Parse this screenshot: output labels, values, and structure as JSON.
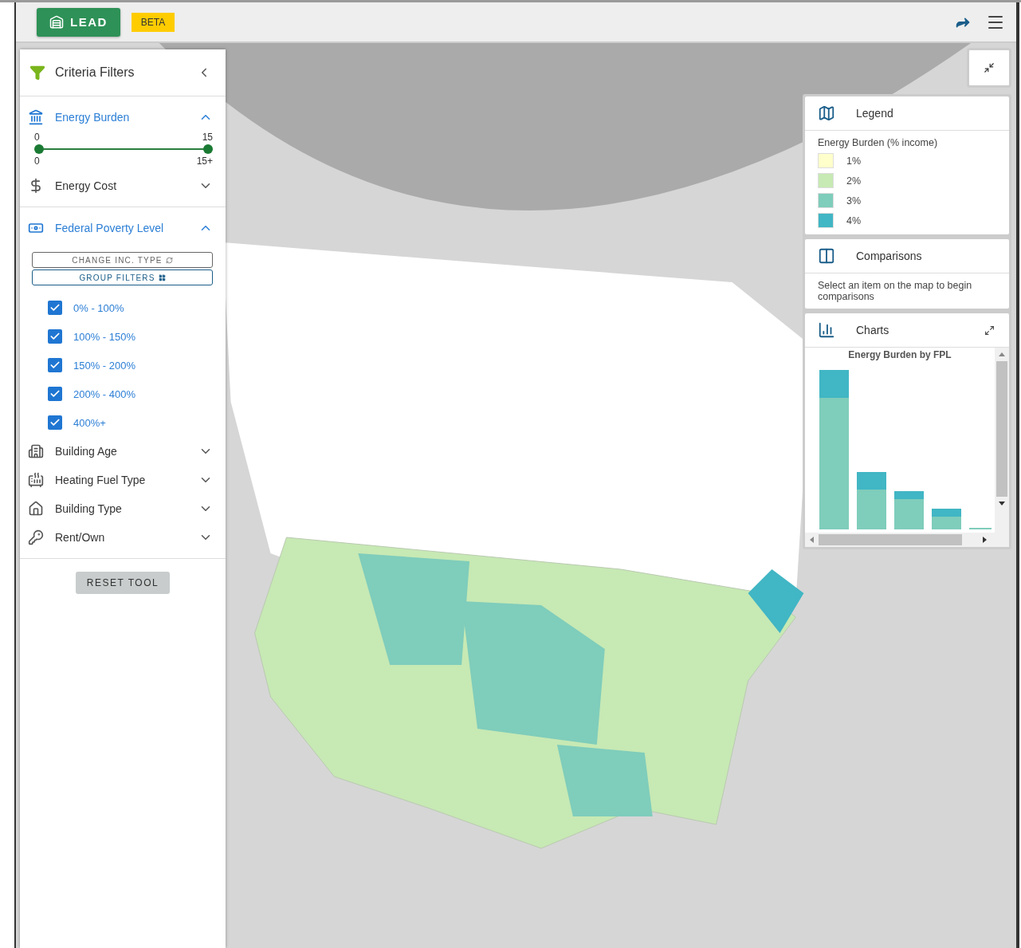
{
  "header": {
    "logo": "LEAD",
    "badge": "BETA"
  },
  "filters": {
    "title": "Criteria Filters",
    "groups": [
      [
        {
          "kind": "slider",
          "label": "Energy Burden",
          "expanded": true,
          "slider": {
            "top_labels": [
              "0",
              "15"
            ],
            "bottom_labels": [
              "0",
              "15+"
            ],
            "thumbs": [
              {
                "level": 0
              },
              {
                "level": 1
              }
            ]
          }
        },
        {
          "kind": "plain",
          "label": "Energy Cost",
          "expanded": false
        }
      ],
      [
        {
          "kind": "checklist",
          "label": "Federal Poverty Level",
          "expanded": true,
          "buttons": [
            "CHANGE INC. TYPE",
            "GROUP FILTERS"
          ],
          "options": [
            {
              "label": "0% - 100%",
              "checked": true
            },
            {
              "label": "100% - 150%",
              "checked": true
            },
            {
              "label": "150% - 200%",
              "checked": true
            },
            {
              "label": "200% - 400%",
              "checked": true
            },
            {
              "label": "400%+",
              "checked": true
            }
          ]
        },
        {
          "kind": "plain",
          "label": "Building Age",
          "expanded": false
        },
        {
          "kind": "plain",
          "label": "Heating Fuel Type",
          "expanded": false
        },
        {
          "kind": "plain",
          "label": "Building Type",
          "expanded": false
        },
        {
          "kind": "plain",
          "label": "Rent/Own",
          "expanded": false
        }
      ]
    ],
    "reset_button": "RESET TOOL"
  },
  "legend": {
    "title": "Legend",
    "subtitle": "Energy Burden (% income)",
    "items": [
      {
        "label": "1%",
        "color": "#ffffcc"
      },
      {
        "label": "2%",
        "color": "#c7e9b4"
      },
      {
        "label": "3%",
        "color": "#7fcdbb"
      },
      {
        "label": "4%",
        "color": "#41b6c4"
      }
    ]
  },
  "comparisons": {
    "title": "Comparisons",
    "text": "Select an item on the map to begin comparisons"
  },
  "charts": {
    "title": "Charts",
    "chart_title": "Energy Burden by FPL"
  }
}
